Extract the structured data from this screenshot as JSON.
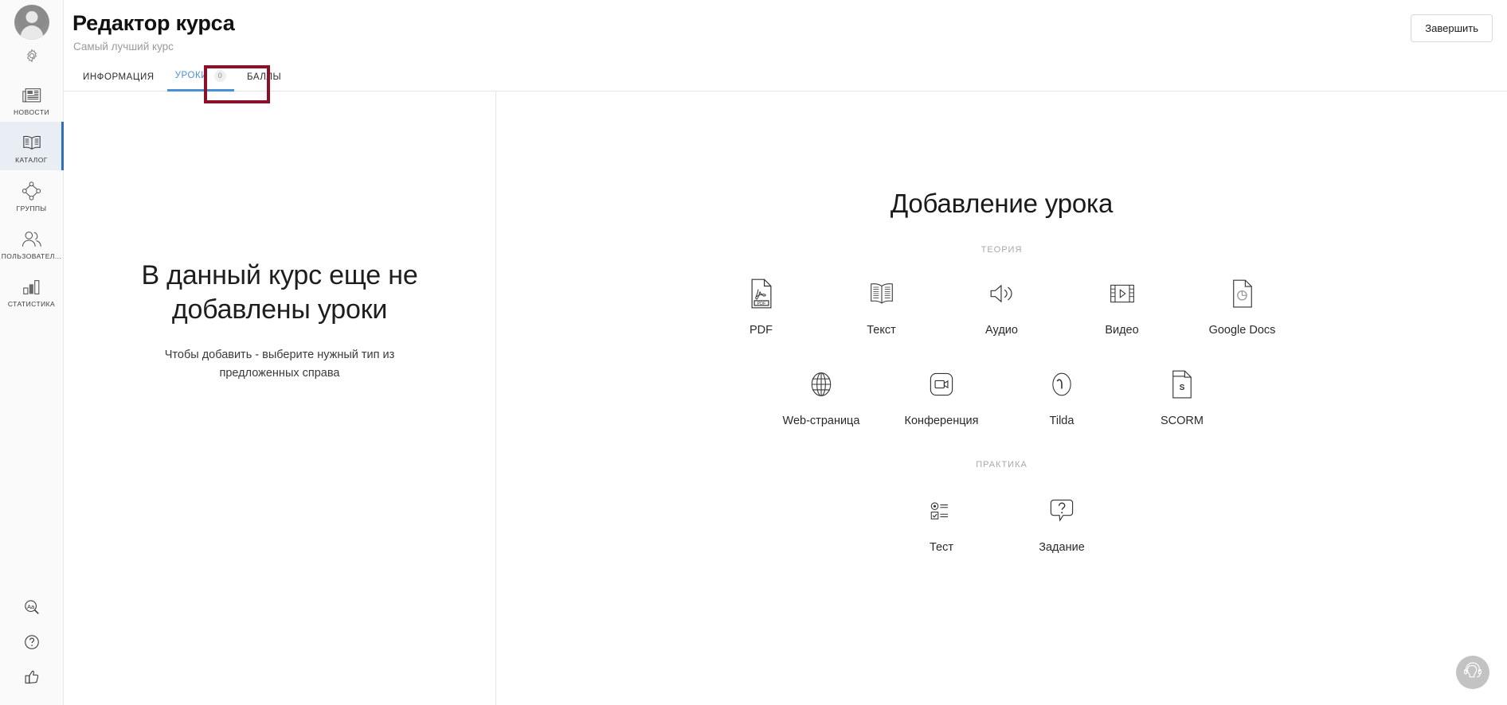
{
  "sidebar": {
    "avatar_name": "user-avatar",
    "settings_label": "settings",
    "items": [
      {
        "label": "НОВОСТИ",
        "icon": "news-icon",
        "active": false
      },
      {
        "label": "КАТАЛОГ",
        "icon": "catalog-icon",
        "active": true
      },
      {
        "label": "ГРУППЫ",
        "icon": "groups-icon",
        "active": false
      },
      {
        "label": "ПОЛЬЗОВАТЕЛ...",
        "icon": "users-icon",
        "active": false
      },
      {
        "label": "СТАТИСТИКА",
        "icon": "statistics-icon",
        "active": false
      }
    ],
    "bottom_icons": [
      "font-size-icon",
      "help-icon",
      "thumbs-up-icon"
    ]
  },
  "header": {
    "title": "Редактор курса",
    "subtitle": "Самый лучший курс",
    "finish_button": "Завершить"
  },
  "tabs": [
    {
      "label": "ИНФОРМАЦИЯ",
      "badge": "",
      "active": false
    },
    {
      "label": "УРОКИ",
      "badge": "0",
      "active": true
    },
    {
      "label": "БАЛЛЫ",
      "badge": "",
      "active": false
    }
  ],
  "annotation": {
    "color": "#8c1026",
    "target": "УРОКИ"
  },
  "empty_state": {
    "title": "В данный курс еще не добавлены уроки",
    "subtitle": "Чтобы добавить - выберите нужный тип из предложенных справа"
  },
  "add_lesson": {
    "title": "Добавление урока",
    "theory_label": "ТЕОРИЯ",
    "practice_label": "ПРАКТИКА",
    "theory_row1": [
      {
        "label": "PDF",
        "icon": "pdf-file-icon"
      },
      {
        "label": "Текст",
        "icon": "open-book-icon"
      },
      {
        "label": "Аудио",
        "icon": "speaker-icon"
      },
      {
        "label": "Видео",
        "icon": "film-strip-icon"
      },
      {
        "label": "Google Docs",
        "icon": "google-docs-icon"
      }
    ],
    "theory_row2": [
      {
        "label": "Web-страница",
        "icon": "globe-icon"
      },
      {
        "label": "Конференция",
        "icon": "video-camera-icon"
      },
      {
        "label": "Tilda",
        "icon": "tilda-icon"
      },
      {
        "label": "SCORM",
        "icon": "scorm-file-icon"
      }
    ],
    "practice_row": [
      {
        "label": "Тест",
        "icon": "quiz-list-icon"
      },
      {
        "label": "Задание",
        "icon": "question-bubble-icon"
      }
    ]
  },
  "support": {
    "label": "support-headset"
  },
  "colors": {
    "accent": "#4a90d9",
    "annotation": "#8c1026",
    "rail_active_bg": "#e9eef5"
  }
}
